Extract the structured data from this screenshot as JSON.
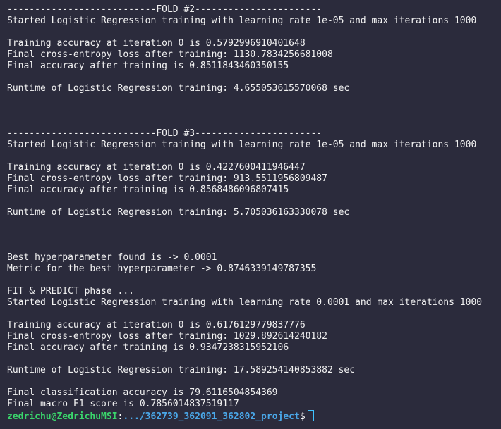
{
  "terminal": {
    "lines": [
      "---------------------------FOLD #2-----------------------",
      "Started Logistic Regression training with learning rate 1e-05 and max iterations 1000",
      "",
      "Training accuracy at iteration 0 is 0.5792996910401648",
      "Final cross-entropy loss after training: 1130.7834256681008",
      "Final accuracy after training is 0.8511843460350155",
      "",
      "Runtime of Logistic Regression training: 4.655053615570068 sec",
      "",
      "",
      "",
      "---------------------------FOLD #3-----------------------",
      "Started Logistic Regression training with learning rate 1e-05 and max iterations 1000",
      "",
      "Training accuracy at iteration 0 is 0.4227600411946447",
      "Final cross-entropy loss after training: 913.5511956809487",
      "Final accuracy after training is 0.8568486096807415",
      "",
      "Runtime of Logistic Regression training: 5.705036163330078 sec",
      "",
      "",
      "",
      "Best hyperparameter found is -> 0.0001",
      "Metric for the best hyperparameter -> 0.8746339149787355",
      "",
      "FIT & PREDICT phase ...",
      "Started Logistic Regression training with learning rate 0.0001 and max iterations 1000",
      "",
      "Training accuracy at iteration 0 is 0.6176129779837776",
      "Final cross-entropy loss after training: 1029.892614240182",
      "Final accuracy after training is 0.9347238315952106",
      "",
      "Runtime of Logistic Regression training: 17.589254140853882 sec",
      "",
      "Final classification accuracy is 79.6116504854369",
      "Final macro F1 score is 0.7856014837519117"
    ],
    "prompt": {
      "user_host": "zedrichu@ZedrichuMSI",
      "separator": ":",
      "path": ".../362739_362091_362802_project",
      "symbol": "$"
    },
    "colors": {
      "background": "#2b2b3c",
      "text": "#f2f2f2",
      "user_host": "#3ad46b",
      "path": "#4aa7e8",
      "cursor": "#3fc3ff"
    }
  }
}
